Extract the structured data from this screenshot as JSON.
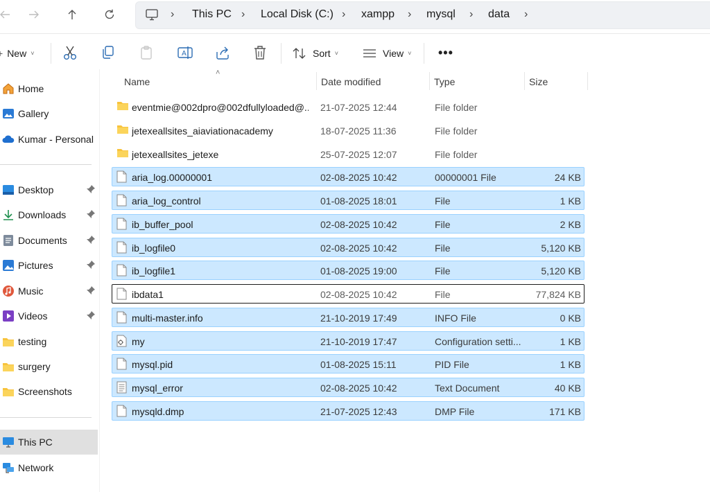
{
  "address": {
    "crumbs": [
      "This PC",
      "Local Disk (C:)",
      "xampp",
      "mysql",
      "data"
    ]
  },
  "toolbar": {
    "new_label": "New",
    "sort_label": "Sort",
    "view_label": "View"
  },
  "sidebar": {
    "items": [
      {
        "label": "Home",
        "icon": "home-icon"
      },
      {
        "label": "Gallery",
        "icon": "gallery-icon"
      },
      {
        "label": "Kumar - Personal",
        "icon": "cloud-icon"
      },
      {
        "label": "Desktop",
        "icon": "desktop-icon",
        "pinned": true
      },
      {
        "label": "Downloads",
        "icon": "download-icon",
        "pinned": true
      },
      {
        "label": "Documents",
        "icon": "documents-icon",
        "pinned": true
      },
      {
        "label": "Pictures",
        "icon": "pictures-icon",
        "pinned": true
      },
      {
        "label": "Music",
        "icon": "music-icon",
        "pinned": true
      },
      {
        "label": "Videos",
        "icon": "videos-icon",
        "pinned": true
      },
      {
        "label": "testing",
        "icon": "folder-icon"
      },
      {
        "label": "surgery",
        "icon": "folder-icon"
      },
      {
        "label": "Screenshots",
        "icon": "folder-icon"
      },
      {
        "label": "This PC",
        "icon": "pc-icon",
        "selected": true
      },
      {
        "label": "Network",
        "icon": "network-icon"
      }
    ]
  },
  "columns": {
    "name": "Name",
    "date": "Date modified",
    "type": "Type",
    "size": "Size"
  },
  "files": [
    {
      "name": "eventmie@002dpro@002dfullyloaded@...",
      "date": "21-07-2025 12:44",
      "type": "File folder",
      "size": "",
      "kind": "folder",
      "state": "none"
    },
    {
      "name": "jetexeallsites_aiaviationacademy",
      "date": "18-07-2025 11:36",
      "type": "File folder",
      "size": "",
      "kind": "folder",
      "state": "none"
    },
    {
      "name": "jetexeallsites_jetexe",
      "date": "25-07-2025 12:07",
      "type": "File folder",
      "size": "",
      "kind": "folder",
      "state": "none"
    },
    {
      "name": "aria_log.00000001",
      "date": "02-08-2025 10:42",
      "type": "00000001 File",
      "size": "24 KB",
      "kind": "file",
      "state": "sel"
    },
    {
      "name": "aria_log_control",
      "date": "01-08-2025 18:01",
      "type": "File",
      "size": "1 KB",
      "kind": "file",
      "state": "sel"
    },
    {
      "name": "ib_buffer_pool",
      "date": "02-08-2025 10:42",
      "type": "File",
      "size": "2 KB",
      "kind": "file",
      "state": "sel"
    },
    {
      "name": "ib_logfile0",
      "date": "02-08-2025 10:42",
      "type": "File",
      "size": "5,120 KB",
      "kind": "file",
      "state": "sel"
    },
    {
      "name": "ib_logfile1",
      "date": "01-08-2025 19:00",
      "type": "File",
      "size": "5,120 KB",
      "kind": "file",
      "state": "sel"
    },
    {
      "name": "ibdata1",
      "date": "02-08-2025 10:42",
      "type": "File",
      "size": "77,824 KB",
      "kind": "file",
      "state": "focus"
    },
    {
      "name": "multi-master.info",
      "date": "21-10-2019 17:49",
      "type": "INFO File",
      "size": "0 KB",
      "kind": "file",
      "state": "sel"
    },
    {
      "name": "my",
      "date": "21-10-2019 17:47",
      "type": "Configuration setti...",
      "size": "1 KB",
      "kind": "config",
      "state": "sel"
    },
    {
      "name": "mysql.pid",
      "date": "01-08-2025 15:11",
      "type": "PID File",
      "size": "1 KB",
      "kind": "file",
      "state": "sel"
    },
    {
      "name": "mysql_error",
      "date": "02-08-2025 10:42",
      "type": "Text Document",
      "size": "40 KB",
      "kind": "text",
      "state": "sel"
    },
    {
      "name": "mysqld.dmp",
      "date": "21-07-2025 12:43",
      "type": "DMP File",
      "size": "171 KB",
      "kind": "file",
      "state": "sel"
    }
  ],
  "colors": {
    "selection_bg": "#cce8ff",
    "selection_border": "#99d1ff",
    "folder_yellow": "#f8c33c",
    "accent_blue": "#0078d4"
  }
}
